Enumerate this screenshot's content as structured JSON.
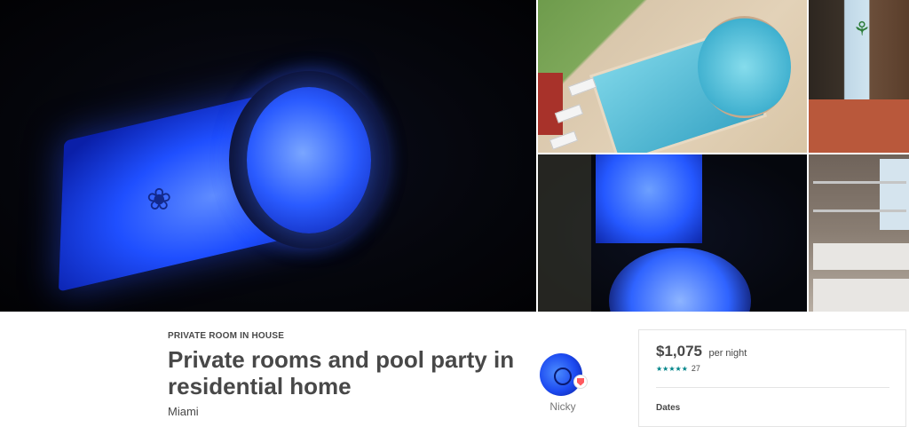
{
  "gallery": {
    "photos": [
      {
        "id": "main",
        "desc_icon": "pool-night"
      },
      {
        "id": "day",
        "desc_icon": "pool-day"
      },
      {
        "id": "room",
        "desc_icon": "bedroom-window"
      },
      {
        "id": "night2",
        "desc_icon": "spa-night"
      },
      {
        "id": "bunk",
        "desc_icon": "bunk-bed"
      }
    ]
  },
  "listing": {
    "room_type": "PRIVATE ROOM IN HOUSE",
    "title": "Private rooms and pool party in residential home",
    "city": "Miami"
  },
  "host": {
    "name": "Nicky"
  },
  "booking": {
    "price": "$1,075",
    "per_night": "per night",
    "stars": "★★★★★",
    "review_count": "27",
    "dates_label": "Dates"
  },
  "colors": {
    "accent_teal": "#008489",
    "text": "#484848",
    "superhost_badge": "#ff5a5f"
  }
}
